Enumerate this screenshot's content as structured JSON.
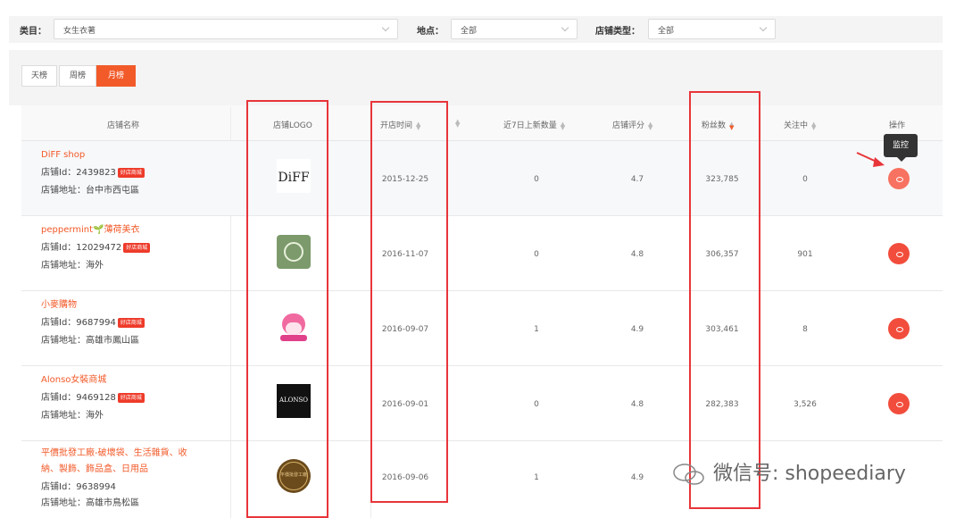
{
  "filters": {
    "category_label": "类目：",
    "category_value": "女生衣著",
    "location_label": "地点：",
    "location_value": "全部",
    "shop_type_label": "店铺类型：",
    "shop_type_value": "全部"
  },
  "tabs": [
    {
      "label": "天榜",
      "active": false
    },
    {
      "label": "周榜",
      "active": false
    },
    {
      "label": "月榜",
      "active": true
    }
  ],
  "columns": {
    "shop_name": "店铺名称",
    "logo": "店铺LOGO",
    "open_time": "开店时间",
    "new_items_7d": "近7日上新数量",
    "rating": "店铺评分",
    "followers": "粉丝数",
    "following": "关注中",
    "action": "操作"
  },
  "id_prefix": "店铺Id：",
  "addr_prefix": "店铺地址：",
  "badge_text": "好店商城",
  "rows": [
    {
      "name": "DiFF shop",
      "id": "2439823",
      "address": "台中市西屯區",
      "open_time": "2015-12-25",
      "new_items": "0",
      "rating": "4.7",
      "followers": "323,785",
      "following": "0",
      "logo_text": "DiFF"
    },
    {
      "name": "peppermint🌱薄荷美衣",
      "id": "12029472",
      "address": "海外",
      "open_time": "2016-11-07",
      "new_items": "0",
      "rating": "4.8",
      "followers": "306,357",
      "following": "901",
      "logo_text": ""
    },
    {
      "name": "小麥購物",
      "id": "9687994",
      "address": "高雄市鳳山區",
      "open_time": "2016-09-07",
      "new_items": "1",
      "rating": "4.9",
      "followers": "303,461",
      "following": "8",
      "logo_text": ""
    },
    {
      "name": "Alonso女裝商城",
      "id": "9469128",
      "address": "海外",
      "open_time": "2016-09-01",
      "new_items": "0",
      "rating": "4.8",
      "followers": "282,383",
      "following": "3,526",
      "logo_text": "ALONSO"
    },
    {
      "name_line1": "平價批發工廠-破壞袋、生活雜貨、收",
      "name_line2": "納、製飾、飾品盒、日用品",
      "id": "9638994",
      "address": "高雄市鳥松區",
      "open_time": "2016-09-06",
      "new_items": "1",
      "rating": "4.9",
      "logo_text": "平價批發工廠"
    }
  ],
  "tooltip": "监控",
  "watermark": "微信号: shopeediary",
  "colors": {
    "accent": "#f25a29",
    "highlight_box": "#e8353a",
    "action_button": "#f24d3c"
  }
}
